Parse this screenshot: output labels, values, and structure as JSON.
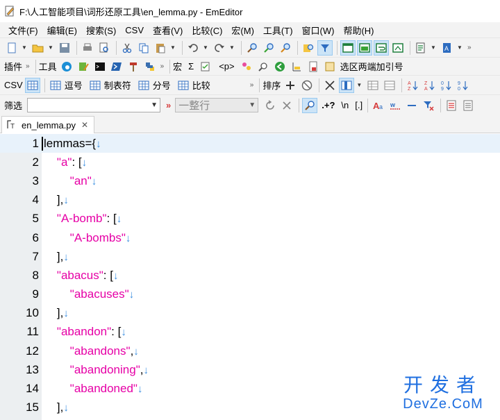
{
  "window": {
    "title": "F:\\人工智能项目\\词形还原工具\\en_lemma.py - EmEditor"
  },
  "menu": [
    "文件(F)",
    "编辑(E)",
    "搜索(S)",
    "CSV",
    "查看(V)",
    "比较(C)",
    "宏(M)",
    "工具(T)",
    "窗口(W)",
    "帮助(H)"
  ],
  "toolbar2": {
    "plugins_label": "插件",
    "tools_label": "工具",
    "macro_label": "宏",
    "sigma_label": "Σ",
    "p_tag_label": "<p>",
    "select_both_label": "选区两端加引号"
  },
  "toolbar3": {
    "csv_label": "CSV",
    "comma_label": "逗号",
    "tab_label": "制表符",
    "semicolon_label": "分号",
    "compare_label": "比较",
    "sort_label": "排序"
  },
  "toolbar4": {
    "filter_label": "筛选",
    "filter_value": "",
    "filter_mode": "一整行",
    "regex_label": ".+?",
    "newline_label": "\\n",
    "brackets_label": "[.]"
  },
  "tabs": [
    {
      "label": "en_lemma.py"
    }
  ],
  "editor": {
    "eol_glyph": "↓",
    "lines": [
      {
        "num": "1",
        "parts": [
          {
            "t": "lemmas={",
            "c": "plain"
          }
        ]
      },
      {
        "num": "2",
        "parts": [
          {
            "t": "    ",
            "c": "plain"
          },
          {
            "t": "\"a\"",
            "c": "str"
          },
          {
            "t": ": [",
            "c": "plain"
          }
        ]
      },
      {
        "num": "3",
        "parts": [
          {
            "t": "        ",
            "c": "plain"
          },
          {
            "t": "\"an\"",
            "c": "str"
          }
        ]
      },
      {
        "num": "4",
        "parts": [
          {
            "t": "    ],",
            "c": "plain"
          }
        ]
      },
      {
        "num": "5",
        "parts": [
          {
            "t": "    ",
            "c": "plain"
          },
          {
            "t": "\"A-bomb\"",
            "c": "str"
          },
          {
            "t": ": [",
            "c": "plain"
          }
        ]
      },
      {
        "num": "6",
        "parts": [
          {
            "t": "        ",
            "c": "plain"
          },
          {
            "t": "\"A-bombs\"",
            "c": "str"
          }
        ]
      },
      {
        "num": "7",
        "parts": [
          {
            "t": "    ],",
            "c": "plain"
          }
        ]
      },
      {
        "num": "8",
        "parts": [
          {
            "t": "    ",
            "c": "plain"
          },
          {
            "t": "\"abacus\"",
            "c": "str"
          },
          {
            "t": ": [",
            "c": "plain"
          }
        ]
      },
      {
        "num": "9",
        "parts": [
          {
            "t": "        ",
            "c": "plain"
          },
          {
            "t": "\"abacuses\"",
            "c": "str"
          }
        ]
      },
      {
        "num": "10",
        "parts": [
          {
            "t": "    ],",
            "c": "plain"
          }
        ]
      },
      {
        "num": "11",
        "parts": [
          {
            "t": "    ",
            "c": "plain"
          },
          {
            "t": "\"abandon\"",
            "c": "str"
          },
          {
            "t": ": [",
            "c": "plain"
          }
        ]
      },
      {
        "num": "12",
        "parts": [
          {
            "t": "        ",
            "c": "plain"
          },
          {
            "t": "\"abandons\"",
            "c": "str"
          },
          {
            "t": ",",
            "c": "plain"
          }
        ]
      },
      {
        "num": "13",
        "parts": [
          {
            "t": "        ",
            "c": "plain"
          },
          {
            "t": "\"abandoning\"",
            "c": "str"
          },
          {
            "t": ",",
            "c": "plain"
          }
        ]
      },
      {
        "num": "14",
        "parts": [
          {
            "t": "        ",
            "c": "plain"
          },
          {
            "t": "\"abandoned\"",
            "c": "str"
          }
        ]
      },
      {
        "num": "15",
        "parts": [
          {
            "t": "    ],",
            "c": "plain"
          }
        ]
      }
    ]
  },
  "watermark": {
    "top": "开发者",
    "bottom": "DevZe.CoM"
  },
  "colors": {
    "string": "#e600a6",
    "eol": "#3b8fe0",
    "gutter": "#eceff1",
    "current_line": "#e8f2fb",
    "watermark": "#1f6fe0"
  }
}
